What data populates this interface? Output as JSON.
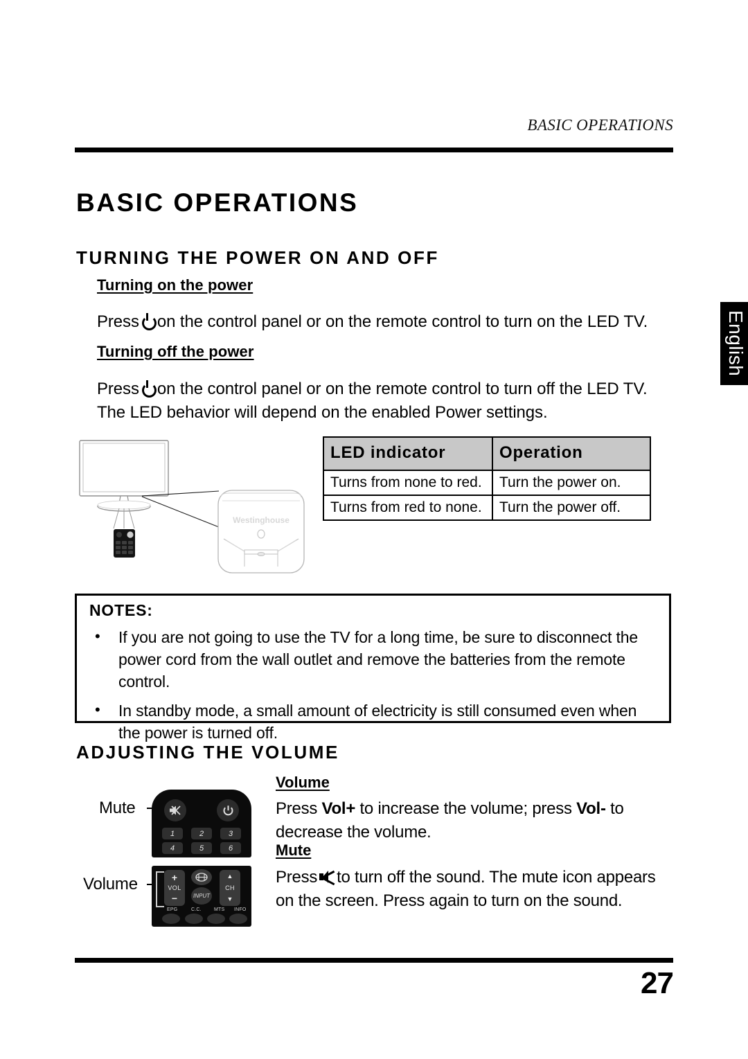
{
  "header": {
    "running_head": "BASIC OPERATIONS"
  },
  "language_tab": {
    "label": "English"
  },
  "footer": {
    "page_number": "27"
  },
  "chapter": {
    "title": "BASIC OPERATIONS"
  },
  "sections": {
    "power": {
      "title": "TURNING THE POWER ON AND OFF",
      "turning_on": {
        "subtitle": "Turning on the power",
        "text_before_icon": "Press",
        "text_after_icon": "on the control panel or on the remote control to turn on the LED TV."
      },
      "turning_off": {
        "subtitle": "Turning off the power ",
        "text_before_icon": "Press",
        "text_after_icon": "on the control panel or on the remote control to turn off the LED TV. The LED behavior will depend on the enabled Power settings."
      },
      "led_table": {
        "columns": [
          "LED indicator",
          "Operation"
        ],
        "rows": [
          [
            "Turns from none to red.",
            "Turn the power on."
          ],
          [
            "Turns from red to none.",
            "Turn the power off."
          ]
        ]
      },
      "illustration": {
        "brand_logo": "Westinghouse"
      }
    },
    "notes": {
      "title": "NOTES:",
      "bullet_char": "•",
      "items": [
        "If you are not going to use the TV for a long time, be sure to disconnect the power cord from the wall outlet and remove the batteries from the remote control.",
        "In standby mode, a small amount of electricity is still consumed even when the power is turned off."
      ]
    },
    "volume": {
      "title": "ADJUSTING THE VOLUME",
      "callouts": {
        "mute": "Mute",
        "volume": "Volume"
      },
      "remote_top": {
        "mute_button": "mute",
        "power_button": "power",
        "number_keys": [
          "1",
          "2",
          "3",
          "4",
          "5",
          "6"
        ]
      },
      "remote_bottom": {
        "vol_plus": "+",
        "vol_label": "VOL",
        "vol_minus": "−",
        "input_label": "INPUT",
        "ch_up": "▲",
        "ch_label": "CH",
        "ch_down": "▼",
        "function_keys": [
          "EPG",
          "C.C.",
          "MTS",
          "INFO"
        ]
      },
      "volume_block": {
        "subtitle": "Volume",
        "part1": "Press ",
        "bold1": "Vol+",
        "part2": " to increase the volume; press ",
        "bold2": "Vol-",
        "part3": " to decrease the volume."
      },
      "mute_block": {
        "subtitle": "Mute",
        "text_before_icon": "Press",
        "text_after_icon": "to turn off the sound. The mute icon appears on the screen. Press again to turn on the sound."
      }
    }
  },
  "colors": {
    "rule": "#000000",
    "table_header_bg": "#c8c8c8",
    "tab_bg": "#000000",
    "tab_text": "#ffffff",
    "remote_body": "#0b0b0b"
  }
}
